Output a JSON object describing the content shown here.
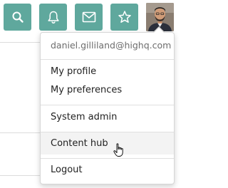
{
  "toolbar": {
    "buttons": [
      {
        "name": "search",
        "icon": "search-icon"
      },
      {
        "name": "notifications",
        "icon": "bell-icon"
      },
      {
        "name": "messages",
        "icon": "envelope-icon"
      },
      {
        "name": "favorites",
        "icon": "star-icon"
      }
    ],
    "accent_color": "#5fa89d"
  },
  "user_menu": {
    "email": "daniel.gilliland@highq.com",
    "items": [
      {
        "label": "My profile"
      },
      {
        "label": "My preferences"
      },
      {
        "label": "System admin"
      },
      {
        "label": "Content hub",
        "hovered": true
      },
      {
        "label": "Logout"
      }
    ]
  }
}
